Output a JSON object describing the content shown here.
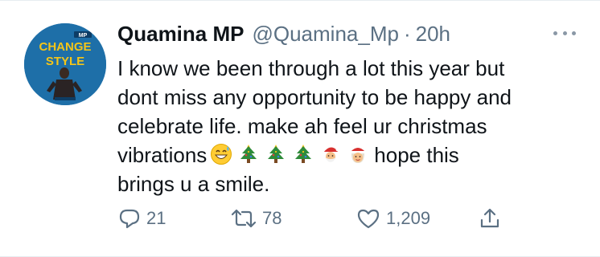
{
  "tweet": {
    "display_name": "Quamina MP",
    "handle": "@Quamina_Mp",
    "separator": "·",
    "timestamp": "20h",
    "text": {
      "line1": "I know we been through a lot this year but",
      "line2": "dont miss any opportunity to be happy and",
      "line3": "celebrate life. make ah feel ur christmas",
      "line4_start": "vibrations",
      "line4_end": "hope this",
      "line5": "brings u a smile."
    },
    "emojis": [
      "grinning-sweat-emoji",
      "christmas-tree-emoji",
      "christmas-tree-emoji",
      "christmas-tree-emoji",
      "santa-emoji",
      "mrs-claus-emoji"
    ],
    "avatar": {
      "line1": "CHANGE",
      "line2": "STYLE",
      "badge": "MP"
    },
    "stats": {
      "replies": "21",
      "retweets": "78",
      "likes": "1,209"
    }
  },
  "colors": {
    "text": "#0f1419",
    "secondary": "#5b7083",
    "divider": "#e6ecf0",
    "avatar_bg": "#1e6fa8",
    "avatar_accent": "#f5c518"
  },
  "icons": {
    "reply": "reply-icon",
    "retweet": "retweet-icon",
    "like": "heart-icon",
    "share": "share-icon",
    "more": "more-icon"
  }
}
